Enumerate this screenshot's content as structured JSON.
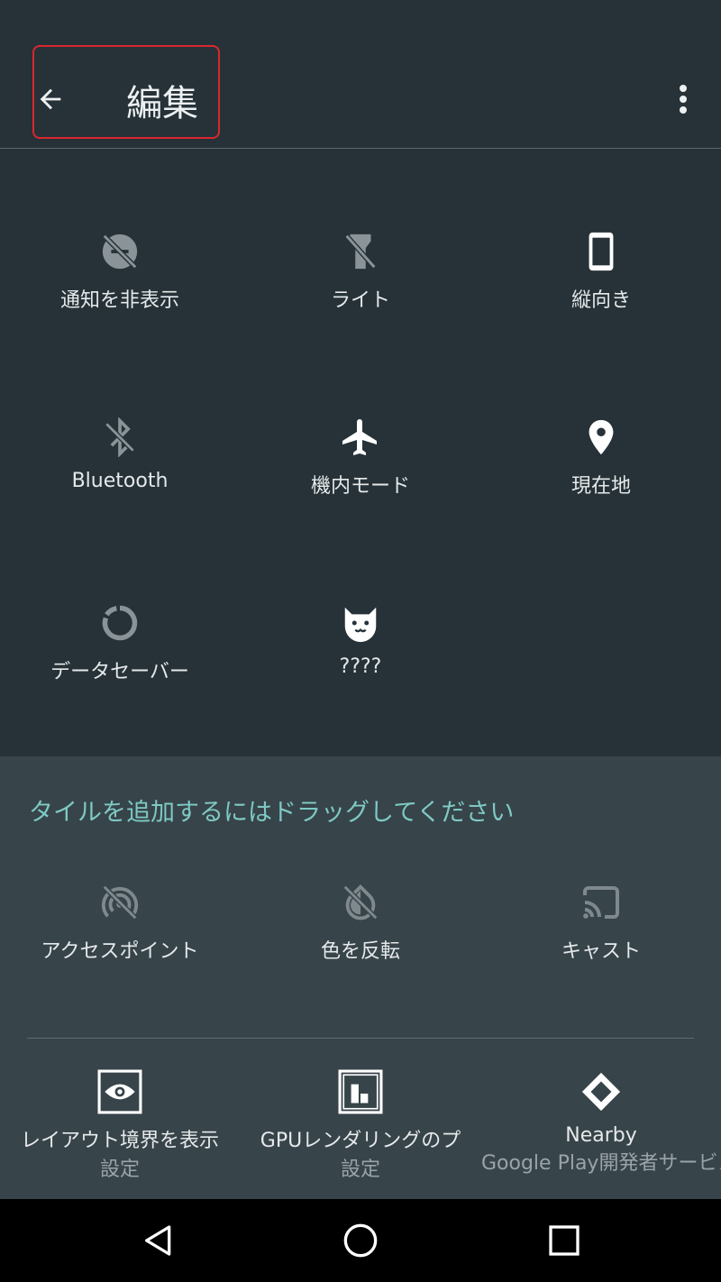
{
  "appbar": {
    "title": "編集"
  },
  "current_tiles": [
    {
      "label": "通知を非表示",
      "icon": "dnd-off-icon"
    },
    {
      "label": "ライト",
      "icon": "flashlight-off-icon"
    },
    {
      "label": "縦向き",
      "icon": "phone-portrait-icon"
    },
    {
      "label": "Bluetooth",
      "icon": "bluetooth-off-icon"
    },
    {
      "label": "機内モード",
      "icon": "airplane-icon"
    },
    {
      "label": "現在地",
      "icon": "location-pin-icon"
    },
    {
      "label": "データセーバー",
      "icon": "data-saver-icon"
    },
    {
      "label": "????",
      "icon": "cat-icon"
    }
  ],
  "available": {
    "hint": "タイルを追加するにはドラッグしてください",
    "system_tiles": [
      {
        "label": "アクセスポイント",
        "icon": "hotspot-off-icon"
      },
      {
        "label": "色を反転",
        "icon": "invert-colors-off-icon"
      },
      {
        "label": "キャスト",
        "icon": "cast-icon"
      }
    ],
    "app_tiles": [
      {
        "label": "レイアウト境界を表示",
        "sub": "設定",
        "icon": "layout-bounds-icon"
      },
      {
        "label": "GPUレンダリングのプ",
        "sub": "設定",
        "icon": "gpu-rendering-icon"
      },
      {
        "label": "Nearby",
        "sub": "Google Play開発者サービス",
        "icon": "nearby-icon"
      }
    ]
  },
  "colors": {
    "background": "#263238",
    "available_bg": "#37444a",
    "accent": "#7fc9c4",
    "highlight": "#d9272d"
  }
}
